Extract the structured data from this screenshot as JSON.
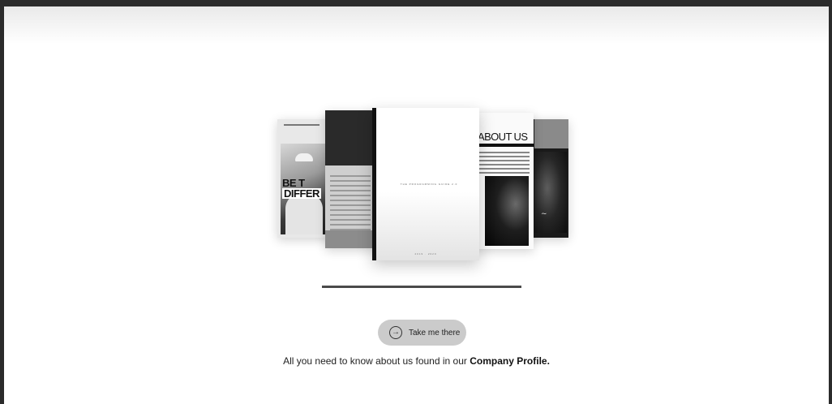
{
  "preview": {
    "page1_title_line1": "BE T",
    "page1_title_line2": "DIFFER",
    "cover_title": "THE PROGRAMMING GUIDE 2.0",
    "cover_footer": "2019 · 2020",
    "about_heading": "ABOUT US"
  },
  "cta": {
    "label": "Take me there",
    "icon": "arrow-right-circle-icon"
  },
  "tagline": {
    "text": "All you need to know about us found in our",
    "link": "Company Profile."
  },
  "colors": {
    "button_bg": "#cbcbcb",
    "bar": "#4a4a4a"
  }
}
